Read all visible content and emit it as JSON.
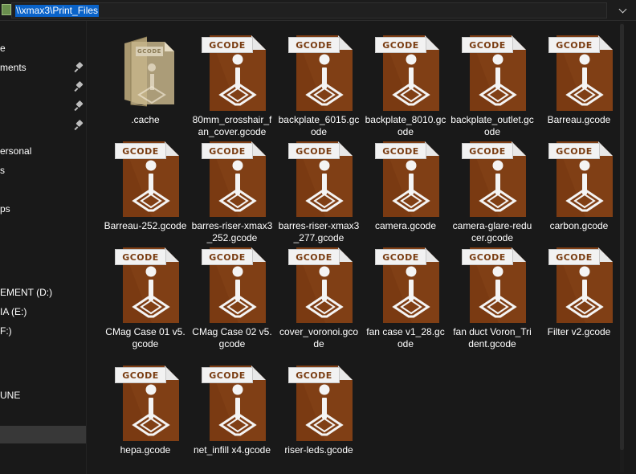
{
  "address": {
    "path": "\\\\xmax3\\Print_Files"
  },
  "sidebar": {
    "items": [
      {
        "label": "e",
        "pinned": false,
        "selected": false
      },
      {
        "label": "ments",
        "pinned": true,
        "selected": false
      },
      {
        "label": "",
        "pinned": true,
        "selected": false
      },
      {
        "label": "",
        "pinned": true,
        "selected": false
      },
      {
        "label": "",
        "pinned": true,
        "selected": false
      },
      {
        "label": "ersonal",
        "pinned": false,
        "selected": false
      },
      {
        "label": "s",
        "pinned": false,
        "selected": false
      },
      {
        "label": "ps",
        "pinned": false,
        "selected": false
      },
      {
        "label": "EMENT (D:)",
        "pinned": false,
        "selected": false
      },
      {
        "label": "IA (E:)",
        "pinned": false,
        "selected": false
      },
      {
        "label": "F:)",
        "pinned": false,
        "selected": false
      },
      {
        "label": "UNE",
        "pinned": false,
        "selected": false
      },
      {
        "label": "",
        "pinned": false,
        "selected": true
      }
    ]
  },
  "file_tag": "GCODE",
  "colors": {
    "gcode_body": "#7a3a12",
    "gcode_body_light": "#8c4a1c",
    "gcode_fold": "#e8e8e8",
    "folder": "#c5b48a",
    "selection": "#0a63c9",
    "background": "#191919"
  },
  "files": [
    {
      "name": ".cache",
      "type": "folder"
    },
    {
      "name": "80mm_crosshair_fan_cover.gcode",
      "type": "gcode"
    },
    {
      "name": "backplate_6015.gcode",
      "type": "gcode"
    },
    {
      "name": "backplate_8010.gcode",
      "type": "gcode"
    },
    {
      "name": "backplate_outlet.gcode",
      "type": "gcode"
    },
    {
      "name": "Barreau.gcode",
      "type": "gcode"
    },
    {
      "name": "Barreau-252.gcode",
      "type": "gcode"
    },
    {
      "name": "barres-riser-xmax3_252.gcode",
      "type": "gcode"
    },
    {
      "name": "barres-riser-xmax3_277.gcode",
      "type": "gcode"
    },
    {
      "name": "camera.gcode",
      "type": "gcode"
    },
    {
      "name": "camera-glare-reducer.gcode",
      "type": "gcode"
    },
    {
      "name": "carbon.gcode",
      "type": "gcode"
    },
    {
      "name": "CMag Case 01 v5.gcode",
      "type": "gcode"
    },
    {
      "name": "CMag Case 02 v5.gcode",
      "type": "gcode"
    },
    {
      "name": "cover_voronoi.gcode",
      "type": "gcode"
    },
    {
      "name": "fan case v1_28.gcode",
      "type": "gcode"
    },
    {
      "name": "fan duct Voron_Trident.gcode",
      "type": "gcode"
    },
    {
      "name": "Filter v2.gcode",
      "type": "gcode"
    },
    {
      "name": "hepa.gcode",
      "type": "gcode"
    },
    {
      "name": "net_infill x4.gcode",
      "type": "gcode"
    },
    {
      "name": "riser-leds.gcode",
      "type": "gcode"
    }
  ]
}
